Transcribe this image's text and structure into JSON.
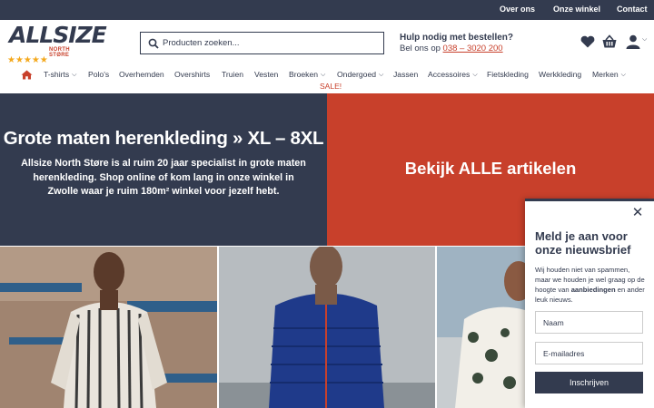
{
  "topbar": {
    "links": [
      "Over ons",
      "Onze winkel",
      "Contact"
    ]
  },
  "logo": {
    "main": "ALLSIZE",
    "sub": "NORTH STØRE",
    "stars": "★★★★★",
    "rating": 5
  },
  "search": {
    "placeholder": "Producten zoeken..."
  },
  "help": {
    "title": "Hulp nodig met bestellen?",
    "call_prefix": "Bel ons op",
    "phone": "038 – 3020 200"
  },
  "header_icons": [
    "heart-icon",
    "basket-icon",
    "user-icon"
  ],
  "nav": {
    "items": [
      {
        "label": "T-shirts",
        "dropdown": true
      },
      {
        "label": "Polo's",
        "dropdown": false
      },
      {
        "label": "Overhemden",
        "dropdown": false
      },
      {
        "label": "Overshirts",
        "dropdown": false
      },
      {
        "label": "Truien",
        "dropdown": false
      },
      {
        "label": "Vesten",
        "dropdown": false
      },
      {
        "label": "Broeken",
        "dropdown": true
      },
      {
        "label": "Ondergoed",
        "dropdown": true
      },
      {
        "label": "Jassen",
        "dropdown": false
      },
      {
        "label": "Accessoires",
        "dropdown": true
      },
      {
        "label": "Fietskleding",
        "dropdown": false
      },
      {
        "label": "Werkkleding",
        "dropdown": false
      },
      {
        "label": "Merken",
        "dropdown": true
      }
    ],
    "sale": "SALE!"
  },
  "hero": {
    "title": "Grote maten herenkleding » XL – 8XL",
    "text": "Allsize North Støre is al ruim 20 jaar specialist in grote maten herenkleding. Shop online of kom lang in onze winkel in Zwolle waar je ruim 180m² winkel voor jezelf hebt.",
    "cta": "Bekijk ALLE artikelen"
  },
  "popup": {
    "title": "Meld je aan voor onze nieuwsbrief",
    "text_before": "Wij houden niet van spammen, maar we houden je wel graag op de hoogte van ",
    "text_bold": "aanbiedingen",
    "text_after": " en ander leuk nieuws.",
    "name_placeholder": "Naam",
    "email_placeholder": "E-mailadres",
    "button": "Inschrijven"
  },
  "colors": {
    "navy": "#333b4f",
    "red": "#c8402b",
    "star": "#f4a81c"
  }
}
